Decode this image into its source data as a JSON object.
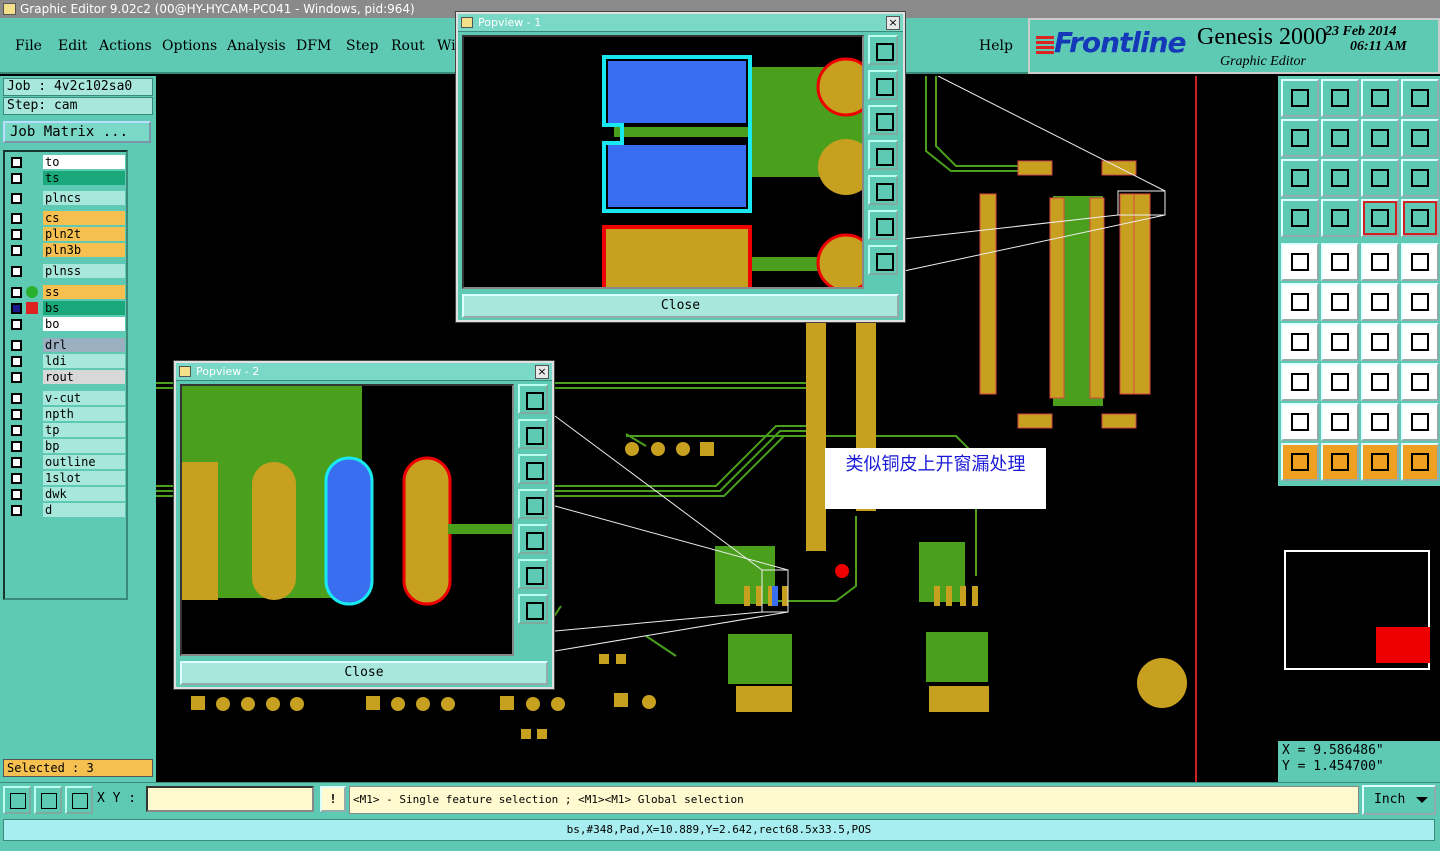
{
  "window": {
    "title": "Graphic Editor 9.02c2 (00@HY-HYCAM-PC041 - Windows, pid:964)"
  },
  "menu": {
    "items": [
      "File",
      "Edit",
      "Actions",
      "Options",
      "Analysis",
      "DFM",
      "Step",
      "Rout",
      "Wi"
    ],
    "help": "Help"
  },
  "brand": {
    "logo": "Frontline",
    "title": "Genesis 2000",
    "subtitle": "Graphic Editor",
    "date": "23 Feb 2014",
    "time": "06:11 AM"
  },
  "job": {
    "job_label": "Job : 4v2c102sa0",
    "step_label": "Step: cam",
    "matrix_button": "Job Matrix ..."
  },
  "layers": [
    {
      "name": "to",
      "color": "#ffffff"
    },
    {
      "name": "ts",
      "color": "#1aa87a"
    },
    {
      "name": "plncs",
      "color": "#a8e8dc"
    },
    {
      "name": "cs",
      "color": "#f5c050"
    },
    {
      "name": "pln2t",
      "color": "#f5c050"
    },
    {
      "name": "pln3b",
      "color": "#f5c050"
    },
    {
      "name": "plnss",
      "color": "#a8e8dc"
    },
    {
      "name": "ss",
      "color": "#f5c050"
    },
    {
      "name": "bs",
      "color": "#1aa87a"
    },
    {
      "name": "bo",
      "color": "#ffffff"
    },
    {
      "name": "drl",
      "color": "#9ab0c0"
    },
    {
      "name": "ldi",
      "color": "#a8e8dc"
    },
    {
      "name": "rout",
      "color": "#d8d8d8"
    },
    {
      "name": "v-cut",
      "color": "#a8e8dc"
    },
    {
      "name": "npth",
      "color": "#a8e8dc"
    },
    {
      "name": "tp",
      "color": "#a8e8dc"
    },
    {
      "name": "bp",
      "color": "#a8e8dc"
    },
    {
      "name": "outline",
      "color": "#a8e8dc"
    },
    {
      "name": "1slot",
      "color": "#a8e8dc"
    },
    {
      "name": "dwk",
      "color": "#a8e8dc"
    },
    {
      "name": "d",
      "color": "#a8e8dc"
    }
  ],
  "selected": "Selected : 3",
  "popup1": {
    "title": "Popview - 1",
    "close_label": "Close"
  },
  "popup2": {
    "title": "Popview - 2",
    "close_label": "Close"
  },
  "callout": "类似铜皮上开窗漏处理",
  "coords": {
    "x": "X = 9.586486\"",
    "y": "Y = 1.454700\""
  },
  "command": {
    "xy_label": "X Y :",
    "xy_value": "",
    "warn": "!",
    "message": "<M1> - Single feature selection ; <M1><M1> Global selection",
    "unit": "Inch"
  },
  "status": "bs,#348,Pad,X=10.889,Y=2.642,rect68.5x33.5,POS"
}
